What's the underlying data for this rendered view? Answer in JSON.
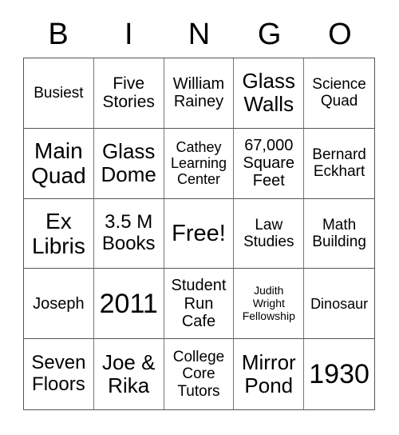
{
  "header": [
    "B",
    "I",
    "N",
    "G",
    "O"
  ],
  "cells": [
    "Busiest",
    "Five\nStories",
    "William\nRainey",
    "Glass\nWalls",
    "Science\nQuad",
    "Main\nQuad",
    "Glass\nDome",
    "Cathey\nLearning\nCenter",
    "67,000\nSquare\nFeet",
    "Bernard\nEckhart",
    "Ex\nLibris",
    "3.5 M\nBooks",
    "Free!",
    "Law\nStudies",
    "Math\nBuilding",
    "Joseph",
    "2011",
    "Student\nRun\nCafe",
    "Judith\nWright\nFellowship",
    "Dinosaur",
    "Seven\nFloors",
    "Joe &\nRika",
    "College\nCore\nTutors",
    "Mirror\nPond",
    "1930"
  ]
}
